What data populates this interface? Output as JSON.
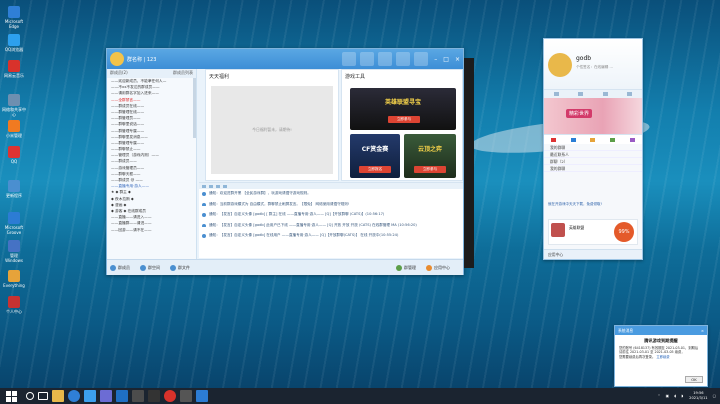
{
  "desktop": {
    "icons": [
      {
        "label": "Microsoft Edge",
        "color": "#2f7fd6"
      },
      {
        "label": "QQ浏览器",
        "color": "#2da0ee"
      },
      {
        "label": "网易云音乐",
        "color": "#d8322b"
      },
      {
        "label": "网络和共享中心",
        "color": "#6e8fb0"
      },
      {
        "label": "小米管理",
        "color": "#f07a21"
      },
      {
        "label": "QQ",
        "color": "#d33"
      },
      {
        "label": "更新程序",
        "color": "#4a8fd0"
      },
      {
        "label": "Microsoft Groove",
        "color": "#2c7cd4"
      },
      {
        "label": "管理Windows",
        "color": "#4572c4"
      },
      {
        "label": "Everything",
        "color": "#e6a33a"
      },
      {
        "label": "个人中心",
        "color": "#c83232"
      }
    ]
  },
  "group_window": {
    "title": "群名称 | 123",
    "sidebar_header_left": "群成员(2)",
    "sidebar_header_right": "群成员列表",
    "members": [
      {
        "text": "——欢迎新成员，不能拿任何人—",
        "style": ""
      },
      {
        "text": "——不xx不发达的群成员——",
        "style": ""
      },
      {
        "text": "——请用群名字加入进来——",
        "style": ""
      },
      {
        "text": "——全群禁言——",
        "style": "red"
      },
      {
        "text": "——群成员在线——",
        "style": ""
      },
      {
        "text": "——群管理在线——",
        "style": ""
      },
      {
        "text": "——群管理员——",
        "style": ""
      },
      {
        "text": "——群聊里说话——",
        "style": ""
      },
      {
        "text": "——群管理专属——",
        "style": ""
      },
      {
        "text": "——群聊里发消息——",
        "style": ""
      },
      {
        "text": "——群管理专属——",
        "style": ""
      },
      {
        "text": "——群聊禁止——",
        "style": ""
      },
      {
        "text": "——管理员（游戏内测）——",
        "style": ""
      },
      {
        "text": "——群成员——",
        "style": ""
      },
      {
        "text": "——游戏管理员——",
        "style": ""
      },
      {
        "text": "——群聊天框——",
        "style": ""
      },
      {
        "text": "——群成员 @ ——",
        "style": ""
      },
      {
        "text": "——直播专用·游人——",
        "style": "blue"
      },
      {
        "text": "★ ◆ 群主 ◆",
        "style": ""
      },
      {
        "text": "◆ 夜木拉斯 ◆",
        "style": ""
      },
      {
        "text": "◆ 漫画 ◆",
        "style": ""
      },
      {
        "text": "◆ 游客 ◆ 在线群成员",
        "style": ""
      },
      {
        "text": "——直播——请进入——",
        "style": ""
      },
      {
        "text": "——直播群——请进——",
        "style": ""
      },
      {
        "text": "——回游——请不在——",
        "style": ""
      }
    ],
    "announce_title": "天天福利",
    "announce_placeholder": "今日福利暂未，请期待!",
    "games_title": "游戏工具",
    "games": [
      {
        "name": "英雄联盟寻宝",
        "button": "立即参与"
      },
      {
        "name": "CF赏金赛",
        "button": "立即报名"
      },
      {
        "name": "云顶之弈",
        "button": "立即参与"
      }
    ],
    "messages": [
      "通知：欢迎进群开黑 【全民游戏群】，玩游戏请遵守游戏规则。",
      "通知：当前群游戏模式为 自由模式，群聊禁止刷屏发言。【限免】 网络使用请遵守规则!",
      "通知：【发言】自定义头像 [godb] [ 群主] 在线 ——直播专用·游人——  [Q]【开放群聊 (CATS)】(10:56:17)",
      "通知：【发言】自定义头像 [godb] 此用户已下线 ——直播专用·游人——  [Q] 开放 开放 开放 (CATS) 在线群管理 MA (10:56:20)",
      "通知：【发言】自定义头像 [godb] 在线用户 ——直播专用·游人——  [Q]【开放群聊(CATS)】 在线 开放中(10:55:24)"
    ],
    "bottom_items": [
      "群成员",
      "群空间",
      "群文件"
    ],
    "bottom_right": [
      "群管理",
      "应用中心"
    ]
  },
  "qq_panel": {
    "nickname": "godb",
    "signature": "个性签名：在线编辑 ...",
    "banner_text": "精彩世界",
    "groups": [
      "我的群聊",
      "最近联系人",
      "群聊（2）",
      "我的群聊"
    ],
    "news": "就在开游戏中天天下载，免费领取!",
    "ad_percent": "99%",
    "ad_title": "英雄联盟",
    "footer": "应用中心"
  },
  "notice": {
    "header": "系统消息",
    "title": "腾讯游戏到期提醒",
    "body_1": "您的账号 (6418137) 有效期至 2021-03-01，到期后",
    "body_2": "请前往 2021-03-01 至 2021-03-05 续费，",
    "body_3": "您需要续费后再次登录。",
    "link": "立即续费",
    "ok": "OK"
  },
  "taskbar": {
    "time": "19:56",
    "date": "2021/3/11"
  }
}
